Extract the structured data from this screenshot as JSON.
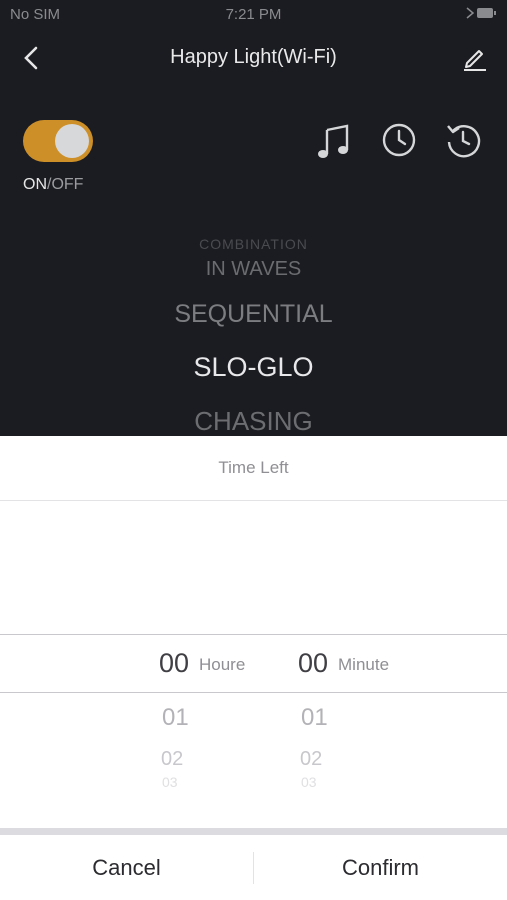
{
  "status_bar": {
    "carrier": "No SIM",
    "time": "7:21 PM"
  },
  "header": {
    "title": "Happy Light(Wi-Fi)"
  },
  "power": {
    "on_label": "ON",
    "separator": "/",
    "off_label": "OFF"
  },
  "toolbar_icons": [
    "music-note-icon",
    "clock-icon",
    "timer-history-icon"
  ],
  "modes": [
    "COMBINATION",
    "IN WAVES",
    "SEQUENTIAL",
    "SLO-GLO",
    "CHASING"
  ],
  "selected_mode": "SLO-GLO",
  "accent_color": "#cd8f28",
  "timer_sheet": {
    "title": "Time Left",
    "hour": {
      "value": "00",
      "unit": "Houre",
      "next": [
        "01",
        "02",
        "03"
      ]
    },
    "minute": {
      "value": "00",
      "unit": "Minute",
      "next": [
        "01",
        "02",
        "03"
      ]
    }
  },
  "actions": {
    "cancel": "Cancel",
    "confirm": "Confirm"
  }
}
